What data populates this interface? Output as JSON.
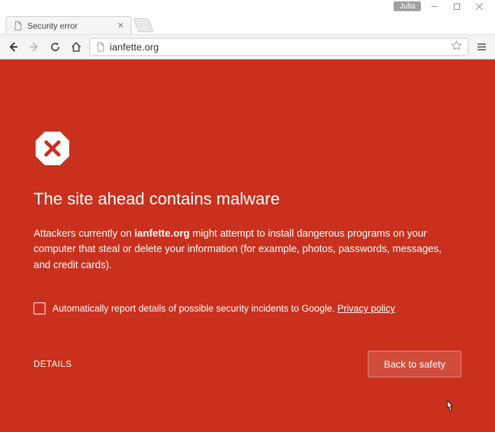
{
  "window": {
    "user_badge": "Julia"
  },
  "tab": {
    "title": "Security error"
  },
  "toolbar": {
    "url": "ianfette.org"
  },
  "interstitial": {
    "heading": "The site ahead contains malware",
    "body_pre": "Attackers currently on ",
    "body_site": "ianfette.org",
    "body_post": " might attempt to install dangerous programs on your computer that steal or delete your information (for example, photos, passwords, messages, and credit cards).",
    "checkbox_label": "Automatically report details of possible security incidents to Google. ",
    "privacy_link": "Privacy policy",
    "details_label": "DETAILS",
    "primary_button": "Back to safety"
  }
}
